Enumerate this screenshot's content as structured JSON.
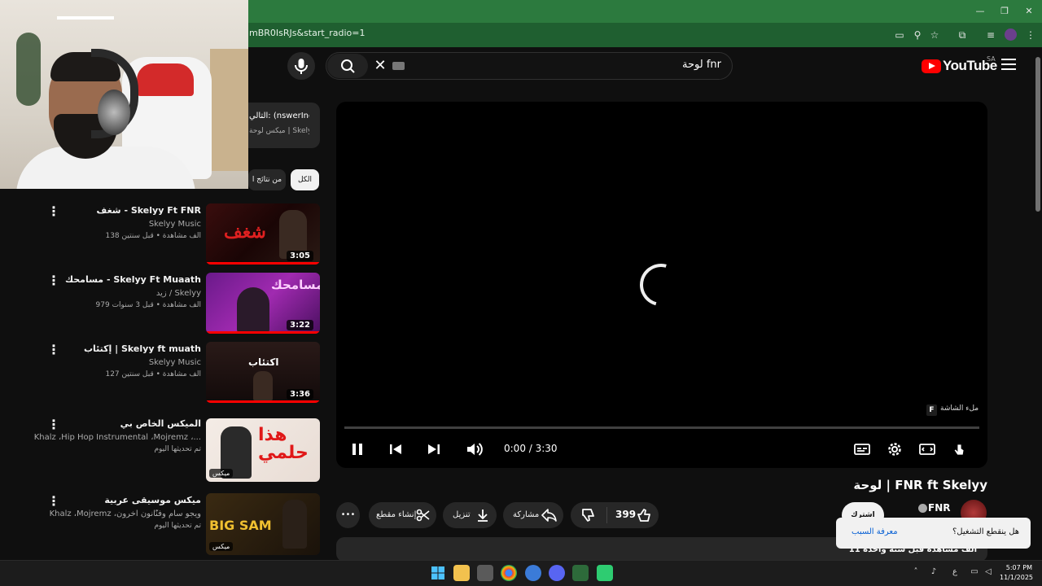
{
  "browser": {
    "url_fragment": "mBR0IsRJs&start_radio=1"
  },
  "header": {
    "logo_text": "YouTube",
    "region": "SA",
    "search_value": "لوحة fnr"
  },
  "up_next": {
    "title": "التالي: (nswerInc",
    "subtitle": "ميكس لوحة | Skelyy"
  },
  "chips": {
    "all": "الكل",
    "from": "من نتائج ا"
  },
  "recommendations": [
    {
      "title": "شغف - Skelyy Ft FNR",
      "channel": "Skelyy Music",
      "meta": "138 ألف مشاهدة • قبل سنتين",
      "duration": "3:05"
    },
    {
      "title": "مسامحك - Skelyy Ft Muaath",
      "channel": "زيد / Skelyy",
      "meta": "979 ألف مشاهدة • قبل 3 سنوات",
      "duration": "3:22"
    },
    {
      "title": "إكتئاب | Skelyy ft muath",
      "channel": "Skelyy Music",
      "meta": "127 ألف مشاهدة • قبل سنتين",
      "duration": "3:36"
    },
    {
      "title": "الميكس الخاص بي",
      "channel": "Khalz ،Hip Hop Instrumental ،Mojremz ،...",
      "meta": "تم تحديثها اليوم",
      "badge": "ميكس"
    },
    {
      "title": "ميكس موسيقى عربية",
      "channel": "Khalz ،Mojremz ،ويجو سام وفنّانون آخرون",
      "meta": "تم تحديثها اليوم",
      "badge": "ميكس"
    }
  ],
  "player": {
    "time": "0:00 / 3:30",
    "fullscreen_hint": "ملء الشاشة",
    "fullscreen_key": "F"
  },
  "video": {
    "title": "لوحة | FNR ft Skelyy",
    "channel": "FNR",
    "subscribe": "اشترك",
    "likes": "399",
    "share": "مشاركة",
    "download": "تنزيل",
    "clip": "إنشاء مقطع",
    "more": "•••",
    "description": "11 ألف مشاهدة  قبل سنة واحدة"
  },
  "toast": {
    "message": "هل ينقطع التشغيل؟",
    "link": "معرفة السبب"
  },
  "taskbar": {
    "time": "5:07 PM",
    "date": "11/1/2025",
    "lang": "ع"
  },
  "colors": {
    "accent": "#ff0000",
    "chrome": "#2c7a3e"
  }
}
